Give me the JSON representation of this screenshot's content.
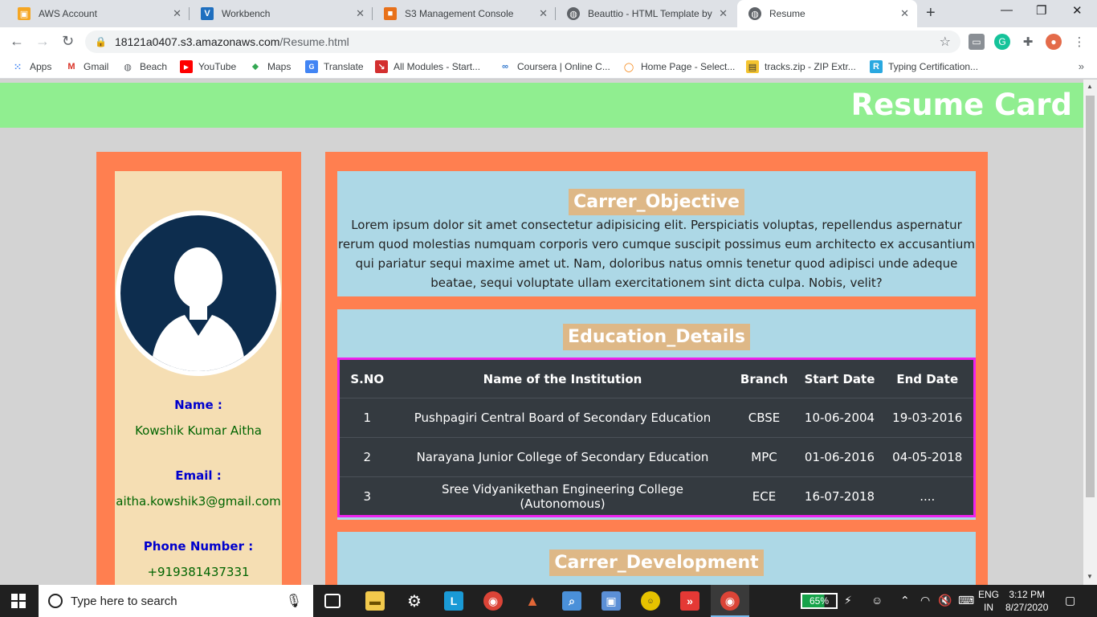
{
  "browser": {
    "tabs": [
      {
        "label": "AWS Account",
        "icon": "aws-cube-icon",
        "color": "#f5a623"
      },
      {
        "label": "Workbench",
        "icon": "vocareum-icon",
        "color": "#1f6fbf"
      },
      {
        "label": "S3 Management Console",
        "icon": "aws-s3-icon",
        "color": "#e8711a"
      },
      {
        "label": "Beauttio - HTML Template by W",
        "icon": "globe-icon",
        "color": "#5f6368"
      },
      {
        "label": "Resume",
        "icon": "globe-icon",
        "color": "#5f6368"
      }
    ],
    "url_host": "18121a0407.s3.amazonaws.com",
    "url_path": "/Resume.html",
    "bookmarks": [
      {
        "label": "Apps"
      },
      {
        "label": "Gmail"
      },
      {
        "label": "Beach"
      },
      {
        "label": "YouTube"
      },
      {
        "label": "Maps"
      },
      {
        "label": "Translate"
      },
      {
        "label": "All Modules - Start..."
      },
      {
        "label": "Coursera | Online C..."
      },
      {
        "label": "Home Page - Select..."
      },
      {
        "label": "tracks.zip - ZIP Extr..."
      },
      {
        "label": "Typing Certification..."
      }
    ]
  },
  "page": {
    "header_title": "Resume Card",
    "profile": {
      "name_label": "Name :",
      "name_value": "Kowshik Kumar Aitha",
      "email_label": "Email :",
      "email_value": "aitha.kowshik3@gmail.com",
      "phone_label": "Phone Number :",
      "phone_value": "+919381437331"
    },
    "objective": {
      "title": "Carrer_Objective",
      "text": "Lorem ipsum dolor sit amet consectetur adipisicing elit. Perspiciatis voluptas, repellendus aspernatur rerum quod molestias numquam corporis vero cumque suscipit possimus eum architecto ex accusantium qui pariatur sequi maxime amet ut. Nam, doloribus natus omnis tenetur quod adipisci unde adeque beatae, sequi voluptate ullam exercitationem sint dicta culpa. Nobis, velit?"
    },
    "education": {
      "title": "Education_Details",
      "headers": [
        "S.NO",
        "Name of the Institution",
        "Branch",
        "Start Date",
        "End Date"
      ],
      "rows": [
        [
          "1",
          "Pushpagiri Central Board of Secondary Education",
          "CBSE",
          "10-06-2004",
          "19-03-2016"
        ],
        [
          "2",
          "Narayana Junior College of Secondary Education",
          "MPC",
          "01-06-2016",
          "04-05-2018"
        ],
        [
          "3",
          "Sree Vidyanikethan Engineering College (Autonomous)",
          "ECE",
          "16-07-2018",
          "...."
        ]
      ]
    },
    "development": {
      "title": "Carrer_Development"
    }
  },
  "taskbar": {
    "search_placeholder": "Type here to search",
    "battery": "65%",
    "lang_top": "ENG",
    "lang_bottom": "IN",
    "time": "3:12 PM",
    "date": "8/27/2020"
  }
}
